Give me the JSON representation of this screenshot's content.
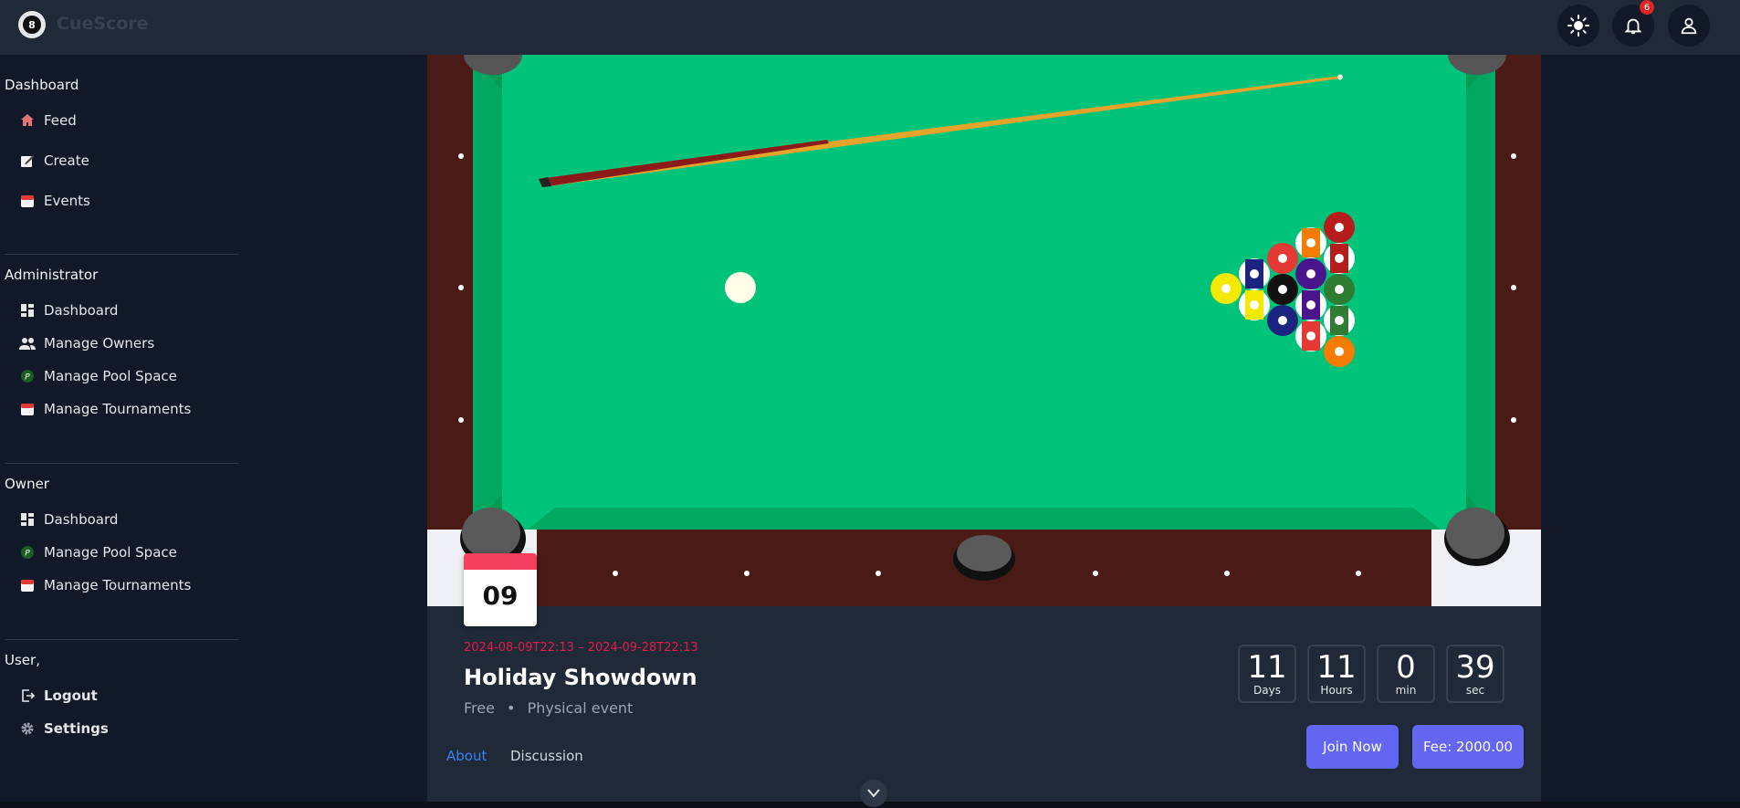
{
  "app": {
    "brand": "CueScore",
    "logo_glyph": "8"
  },
  "topbar": {
    "notification_count": "6"
  },
  "sidebar": {
    "sections": [
      {
        "title": "Dashboard",
        "items": [
          {
            "label": "Feed",
            "icon": "home-icon"
          },
          {
            "label": "Create",
            "icon": "edit-icon"
          },
          {
            "label": "Events",
            "icon": "calendar-icon"
          }
        ]
      },
      {
        "title": "Administrator",
        "items": [
          {
            "label": "Dashboard",
            "icon": "dashboard-icon"
          },
          {
            "label": "Manage Owners",
            "icon": "people-icon"
          },
          {
            "label": "Manage Pool Space",
            "icon": "pool-space-icon"
          },
          {
            "label": "Manage Tournaments",
            "icon": "calendar-icon"
          }
        ]
      },
      {
        "title": "Owner",
        "items": [
          {
            "label": "Dashboard",
            "icon": "dashboard-icon"
          },
          {
            "label": "Manage Pool Space",
            "icon": "pool-space-icon"
          },
          {
            "label": "Manage Tournaments",
            "icon": "calendar-icon"
          }
        ]
      },
      {
        "title": "User,",
        "items": [
          {
            "label": "Logout",
            "icon": "logout-icon"
          },
          {
            "label": "Settings",
            "icon": "gear-icon"
          }
        ]
      }
    ]
  },
  "event": {
    "day": "09",
    "date_range": "2024-08-09T22:13 – 2024-09-28T22:13",
    "title": "Holiday Showdown",
    "price": "Free",
    "separator": "•",
    "type": "Physical event",
    "countdown": [
      {
        "value": "11",
        "label": "Days"
      },
      {
        "value": "11",
        "label": "Hours"
      },
      {
        "value": "0",
        "label": "min"
      },
      {
        "value": "39",
        "label": "sec"
      }
    ],
    "tabs": {
      "about": "About",
      "discussion": "Discussion"
    },
    "join_label": "Join Now",
    "fee_label": "Fee: 2000.00"
  },
  "colors": {
    "felt": "#00c37a",
    "cushion": "#019b55",
    "rail": "#4a1a16",
    "accent": "#6366f1",
    "date_red": "#e11d48"
  }
}
